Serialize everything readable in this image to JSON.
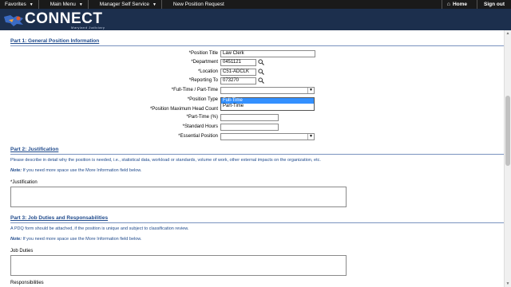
{
  "topnav": {
    "favorites": "Favorites",
    "main_menu": "Main Menu",
    "manager_self_service": "Manager Self Service",
    "page": "New Position Request",
    "home": "Home",
    "sign_out": "Sign out"
  },
  "header": {
    "logo_text": "CONNECT",
    "logo_sub": "Maryland Judiciary",
    "bg_color": "#1c2f4d"
  },
  "part1": {
    "title": "Part 1: General Position Information",
    "fields": {
      "position_title_label": "*Position Title",
      "position_title_value": "Law Clerk",
      "department_label": "*Department",
      "department_value": "0451121",
      "location_label": "*Location",
      "location_value": "C51-ADCLK",
      "reporting_to_label": "*Reporting To",
      "reporting_to_value": "073270",
      "full_part_label": "*Full-Time / Part-Time",
      "position_type_label": "*Position Type",
      "max_head_count_label": "*Position Maximum Head Count",
      "part_time_pct_label": "*Part-Time (%)",
      "standard_hours_label": "*Standard Hours",
      "essential_label": "*Essential Position"
    },
    "dropdown_options": [
      "Full-Time",
      "Part-Time"
    ]
  },
  "part2": {
    "title": "Part 2: Justification",
    "description": "Please describe in detail why the position is needed, i.e., statistical data, workload or standards, volume of work, other external impacts on the organization, etc.",
    "note_label": "Note:",
    "note_text": " If you need more space use the More Information field below.",
    "field_label": "*Justification"
  },
  "part3": {
    "title": "Part 3: Job Duties and Responsabilities",
    "description": "A PDQ form should be attached, if the position is unique and subject to classification review.",
    "note_label": "Note:",
    "note_text": " If you need more space use the More Information field below.",
    "job_duties_label": "Job Duties",
    "responsibilities_label": "Responsibilities"
  }
}
